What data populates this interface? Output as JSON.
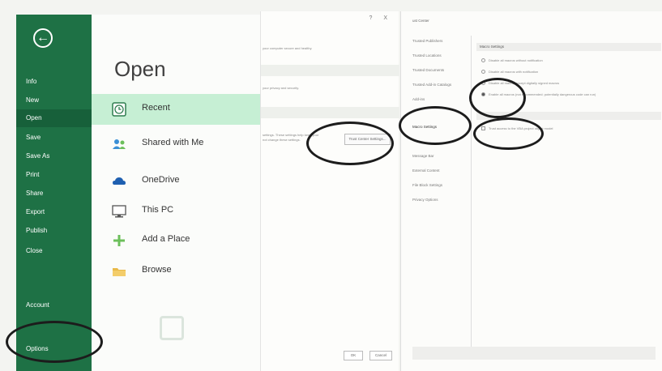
{
  "sidebar": {
    "back_icon": "arrow-left-circle-icon",
    "items": [
      {
        "label": "Info"
      },
      {
        "label": "New"
      },
      {
        "label": "Open",
        "active": true
      },
      {
        "label": "Save"
      },
      {
        "label": "Save As"
      },
      {
        "label": "Print"
      },
      {
        "label": "Share"
      },
      {
        "label": "Export"
      },
      {
        "label": "Publish"
      },
      {
        "label": "Close"
      },
      {
        "label": "Account"
      },
      {
        "label": "Options"
      }
    ]
  },
  "open_panel": {
    "title": "Open",
    "places": [
      {
        "label": "Recent",
        "icon": "clock-icon",
        "selected": true
      },
      {
        "label": "Shared with Me",
        "icon": "people-icon"
      },
      {
        "label": "OneDrive",
        "icon": "cloud-icon"
      },
      {
        "label": "This PC",
        "icon": "monitor-icon"
      },
      {
        "label": "Add a Place",
        "icon": "plus-icon"
      },
      {
        "label": "Browse",
        "icon": "folder-icon"
      }
    ]
  },
  "options_dialog": {
    "title_controls": "? X",
    "text_1": "your computer secure and healthy.",
    "text_2": "your privacy and security.",
    "text_3": "settings. These settings help keep your",
    "text_4": "not change these settings.",
    "trust_center_button": "Trust Center Settings...",
    "ok_button": "OK",
    "cancel_button": "Cancel"
  },
  "trust_center": {
    "title": "ust Center",
    "nav": [
      "Trusted Publishers",
      "Trusted Locations",
      "Trusted Documents",
      "Trusted Add-in Catalogs",
      "Add-ins",
      "",
      "Macro Settings",
      "",
      "Message Bar",
      "External Content",
      "File Block Settings",
      "Privacy Options"
    ],
    "selected_nav": "Macro Settings",
    "macro_section_title": "Macro Settings",
    "macro_options": [
      {
        "label": "Disable all macros without notification",
        "selected": false
      },
      {
        "label": "Disable all macros with notification",
        "selected": false
      },
      {
        "label": "Disable all macros except digitally signed macros",
        "selected": false
      },
      {
        "label": "Enable all macros (not recommended; potentially dangerous code can run)",
        "selected": true
      }
    ],
    "dev_section_title": "",
    "vba_checkbox_label": "Trust access to the VBA project object model"
  },
  "colors": {
    "sidebar_green": "#1e7145",
    "sidebar_active": "#17603a",
    "recent_highlight": "#c6efd4",
    "annotation_ring": "#1c1c1c"
  }
}
